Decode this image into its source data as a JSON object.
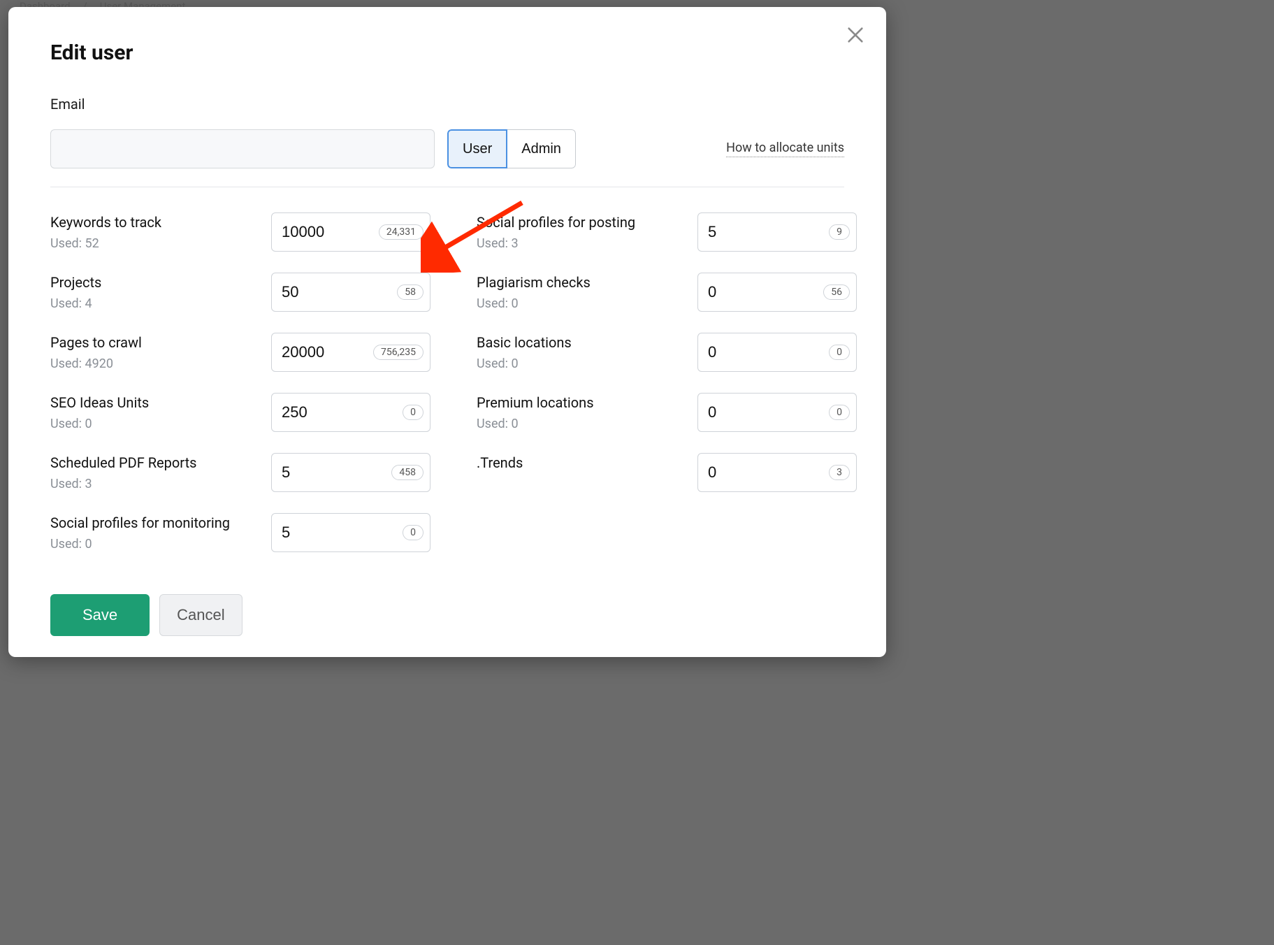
{
  "backdrop": {
    "crumb1": "Dashboard",
    "crumb2": "User Management"
  },
  "modal": {
    "title": "Edit user",
    "email_label": "Email",
    "email_value": "",
    "role_user": "User",
    "role_admin": "Admin",
    "help_link": "How to allocate units",
    "save_label": "Save",
    "cancel_label": "Cancel"
  },
  "limits_left": [
    {
      "label": "Keywords to track",
      "used_prefix": "Used: ",
      "used": "52",
      "value": "10000",
      "badge": "24,331"
    },
    {
      "label": "Projects",
      "used_prefix": "Used: ",
      "used": "4",
      "value": "50",
      "badge": "58"
    },
    {
      "label": "Pages to crawl",
      "used_prefix": "Used: ",
      "used": "4920",
      "value": "20000",
      "badge": "756,235"
    },
    {
      "label": "SEO Ideas Units",
      "used_prefix": "Used: ",
      "used": "0",
      "value": "250",
      "badge": "0"
    },
    {
      "label": "Scheduled PDF Reports",
      "used_prefix": "Used: ",
      "used": "3",
      "value": "5",
      "badge": "458"
    },
    {
      "label": "Social profiles for monitoring",
      "used_prefix": "Used: ",
      "used": "0",
      "value": "5",
      "badge": "0"
    }
  ],
  "limits_right": [
    {
      "label": "Social profiles for posting",
      "used_prefix": "Used: ",
      "used": "3",
      "value": "5",
      "badge": "9"
    },
    {
      "label": "Plagiarism checks",
      "used_prefix": "Used: ",
      "used": "0",
      "value": "0",
      "badge": "56"
    },
    {
      "label": "Basic locations",
      "used_prefix": "Used: ",
      "used": "0",
      "value": "0",
      "badge": "0"
    },
    {
      "label": "Premium locations",
      "used_prefix": "Used: ",
      "used": "0",
      "value": "0",
      "badge": "0"
    },
    {
      "label": ".Trends",
      "used_prefix": "",
      "used": "",
      "value": "0",
      "badge": "3"
    }
  ]
}
